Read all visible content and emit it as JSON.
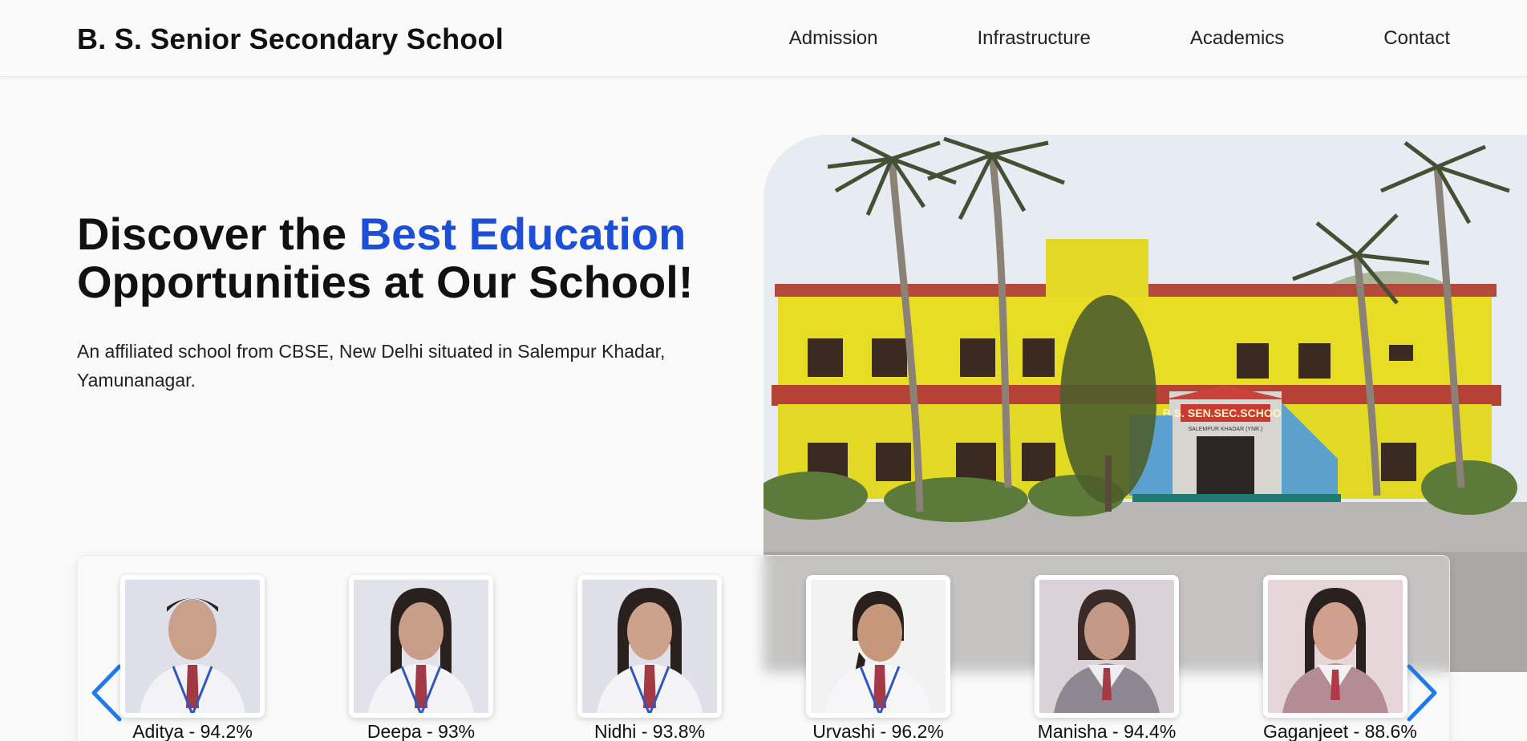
{
  "header": {
    "brand": "B. S. Senior Secondary School",
    "nav": [
      "Admission",
      "Infrastructure",
      "Academics",
      "Contact"
    ]
  },
  "hero": {
    "title_part1": "Discover the ",
    "title_accent": "Best Education",
    "title_part2": "Opportunities at Our School!",
    "subtitle": "An affiliated school from CBSE, New Delhi situated in Salempur Khadar, Yamunanagar.",
    "image_sign": "B.S. SEN.SEC.SCHOOL",
    "image_sign_sub": "SALEMPUR KHADAR (YNR.)"
  },
  "toppers": [
    {
      "label": "Aditya - 94.2%"
    },
    {
      "label": "Deepa - 93%"
    },
    {
      "label": "Nidhi - 93.8%"
    },
    {
      "label": "Urvashi - 96.2%"
    },
    {
      "label": "Manisha - 94.4%"
    },
    {
      "label": "Gaganjeet - 88.6%"
    }
  ],
  "icons": {
    "prev": "chevron-left-icon",
    "next": "chevron-right-icon"
  },
  "colors": {
    "accent": "#1d4ed8",
    "arrow": "#1f7aec",
    "building": "#e8df2a",
    "roof_band": "#b8443a"
  }
}
